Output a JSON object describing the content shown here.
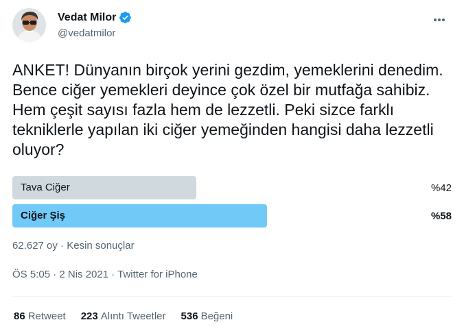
{
  "author": {
    "name": "Vedat Milor",
    "handle": "@vedatmilor",
    "verified": true
  },
  "tweet": {
    "text": "ANKET! Dünyanın birçok yerini gezdim, yemeklerini denedim. Bence ciğer yemekleri deyince çok özel bir mutfağa sahibiz. Hem çeşit sayısı fazla hem de lezzetli. Peki sizce farklı tekniklerle yapılan iki ciğer yemeğinden hangisi daha lezzetli oluyor?"
  },
  "poll": {
    "options": [
      {
        "label": "Tava Ciğer",
        "percent": "%42",
        "share": 0.42,
        "winner": false
      },
      {
        "label": "Ciğer Şiş",
        "percent": "%58",
        "share": 0.58,
        "winner": true
      }
    ],
    "meta": "62.627 oy · Kesin sonuçlar"
  },
  "timestamp": "ÖS 5:05 · 2 Nis 2021 · Twitter for iPhone",
  "stats": [
    {
      "count": "86",
      "label": "Retweet"
    },
    {
      "count": "223",
      "label": "Alıntı Tweetler"
    },
    {
      "count": "536",
      "label": "Beğeni"
    }
  ],
  "colors": {
    "accent": "#1d9bf0",
    "winner_bar": "#71c9f8",
    "loser_bar": "#cfd9de",
    "secondary_text": "#536471"
  },
  "icons": [
    "avatar",
    "verified-badge-icon",
    "more-options-icon"
  ]
}
